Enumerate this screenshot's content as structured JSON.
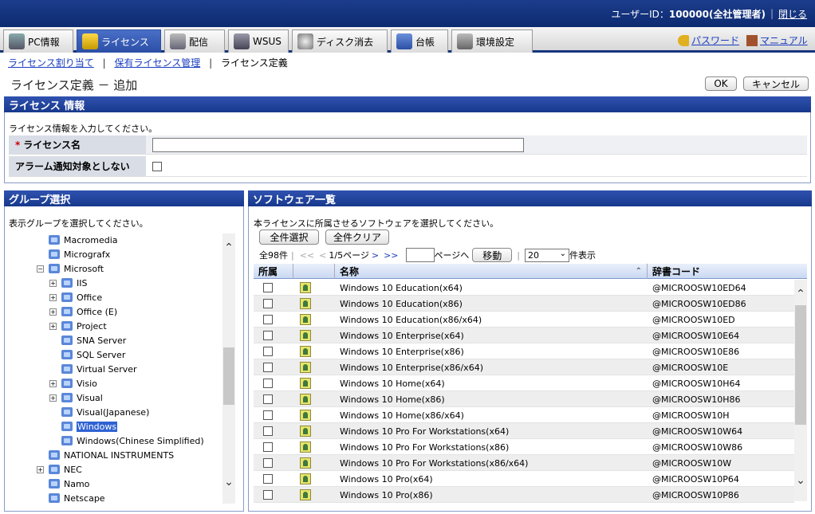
{
  "topbar": {
    "user_label": "ユーザーID：",
    "user_value": "100000(全社管理者)",
    "close_link": "閉じる"
  },
  "nav": {
    "tabs": [
      {
        "label": "PC情報",
        "icon": "pc-icon"
      },
      {
        "label": "ライセンス",
        "icon": "license-icon"
      },
      {
        "label": "配信",
        "icon": "delivery-icon"
      },
      {
        "label": "WSUS",
        "icon": "wsus-icon",
        "badge": "WSUS"
      },
      {
        "label": "ディスク消去",
        "icon": "disk-icon"
      },
      {
        "label": "台帳",
        "icon": "ledger-icon"
      },
      {
        "label": "環境設定",
        "icon": "settings-icon"
      }
    ],
    "password_link": "パスワード",
    "manual_link": "マニュアル"
  },
  "breadcrumb": {
    "item1": "ライセンス割り当て",
    "item2": "保有ライセンス管理",
    "current": "ライセンス定義"
  },
  "page": {
    "title": "ライセンス定義 － 追加",
    "ok": "OK",
    "cancel": "キャンセル"
  },
  "license_info": {
    "header": "ライセンス 情報",
    "instruction": "ライセンス情報を入力してください。",
    "name_label": "ライセンス名",
    "name_value": "",
    "alarm_label": "アラーム通知対象としない",
    "alarm_checked": false
  },
  "group": {
    "header": "グループ選択",
    "instruction": "表示グループを選択してください。",
    "nodes": [
      {
        "label": "Macromedia",
        "level": 1,
        "exp": ""
      },
      {
        "label": "Micrografx",
        "level": 1,
        "exp": ""
      },
      {
        "label": "Microsoft",
        "level": 1,
        "exp": "−"
      },
      {
        "label": "IIS",
        "level": 2,
        "exp": "+"
      },
      {
        "label": "Office",
        "level": 2,
        "exp": "+"
      },
      {
        "label": "Office (E)",
        "level": 2,
        "exp": "+"
      },
      {
        "label": "Project",
        "level": 2,
        "exp": "+"
      },
      {
        "label": "SNA Server",
        "level": 2,
        "exp": ""
      },
      {
        "label": "SQL Server",
        "level": 2,
        "exp": ""
      },
      {
        "label": "Virtual Server",
        "level": 2,
        "exp": ""
      },
      {
        "label": "Visio",
        "level": 2,
        "exp": "+"
      },
      {
        "label": "Visual",
        "level": 2,
        "exp": "+"
      },
      {
        "label": "Visual(Japanese)",
        "level": 2,
        "exp": ""
      },
      {
        "label": "Windows",
        "level": 2,
        "exp": "",
        "selected": true
      },
      {
        "label": "Windows(Chinese Simplified)",
        "level": 2,
        "exp": ""
      },
      {
        "label": "NATIONAL INSTRUMENTS",
        "level": 1,
        "exp": ""
      },
      {
        "label": "NEC",
        "level": 1,
        "exp": "+"
      },
      {
        "label": "Namo",
        "level": 1,
        "exp": ""
      },
      {
        "label": "Netscape",
        "level": 1,
        "exp": ""
      }
    ]
  },
  "software": {
    "header": "ソフトウェア一覧",
    "instruction": "本ライセンスに所属させるソフトウェアを選択してください。",
    "select_all": "全件選択",
    "clear_all": "全件クリア",
    "pager": {
      "total": "全98件",
      "first": "<<",
      "prev": "<",
      "page_info": "1/5ページ",
      "next": ">",
      "last": ">>",
      "goto_suffix": "ページへ",
      "move": "移動",
      "per_page": "20",
      "per_page_suffix": "件表示"
    },
    "columns": {
      "belong": "所属",
      "name": "名称",
      "dict_code": "辞書コード"
    },
    "rows": [
      {
        "name": "Windows 10 Education(x64)",
        "code": "@MICROOSW10ED64"
      },
      {
        "name": "Windows 10 Education(x86)",
        "code": "@MICROOSW10ED86"
      },
      {
        "name": "Windows 10 Education(x86/x64)",
        "code": "@MICROOSW10ED"
      },
      {
        "name": "Windows 10 Enterprise(x64)",
        "code": "@MICROOSW10E64"
      },
      {
        "name": "Windows 10 Enterprise(x86)",
        "code": "@MICROOSW10E86"
      },
      {
        "name": "Windows 10 Enterprise(x86/x64)",
        "code": "@MICROOSW10E"
      },
      {
        "name": "Windows 10 Home(x64)",
        "code": "@MICROOSW10H64"
      },
      {
        "name": "Windows 10 Home(x86)",
        "code": "@MICROOSW10H86"
      },
      {
        "name": "Windows 10 Home(x86/x64)",
        "code": "@MICROOSW10H"
      },
      {
        "name": "Windows 10 Pro For Workstations(x64)",
        "code": "@MICROOSW10W64"
      },
      {
        "name": "Windows 10 Pro For Workstations(x86)",
        "code": "@MICROOSW10W86"
      },
      {
        "name": "Windows 10 Pro For Workstations(x86/x64)",
        "code": "@MICROOSW10W"
      },
      {
        "name": "Windows 10 Pro(x64)",
        "code": "@MICROOSW10P64"
      },
      {
        "name": "Windows 10 Pro(x86)",
        "code": "@MICROOSW10P86"
      }
    ]
  },
  "colors": {
    "header_bg": "#1c3d8c",
    "active_tab": "#2b4fa6",
    "link": "#1a3dbf",
    "selected": "#2f62d3"
  }
}
